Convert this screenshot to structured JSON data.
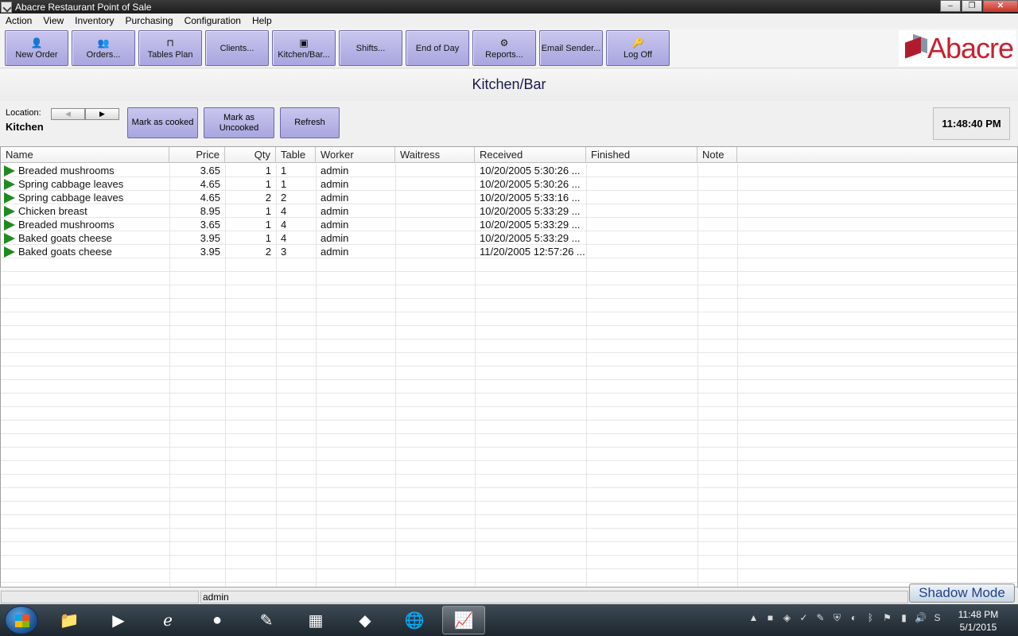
{
  "window": {
    "title": "Abacre Restaurant Point of Sale"
  },
  "menu": [
    "Action",
    "View",
    "Inventory",
    "Purchasing",
    "Configuration",
    "Help"
  ],
  "toolbar": {
    "buttons": [
      "New Order",
      "Orders...",
      "Tables Plan",
      "Clients...",
      "Kitchen/Bar...",
      "Shifts...",
      "End of Day",
      "Reports...",
      "Email Sender...",
      "Log Off"
    ],
    "logo": "Abacre"
  },
  "heading": "Kitchen/Bar",
  "controls": {
    "location_label": "Location:",
    "location_value": "Kitchen",
    "mark_cooked": "Mark as cooked",
    "mark_uncooked": "Mark as Uncooked",
    "refresh": "Refresh",
    "clock": "11:48:40 PM"
  },
  "grid": {
    "columns": [
      "Name",
      "Price",
      "Qty",
      "Table",
      "Worker",
      "Waitress",
      "Received",
      "Finished",
      "Note"
    ],
    "rows": [
      {
        "name": "Breaded mushrooms",
        "price": "3.65",
        "qty": "1",
        "table": "1",
        "worker": "admin",
        "waitress": "",
        "received": "10/20/2005 5:30:26 ...",
        "finished": "",
        "note": ""
      },
      {
        "name": "Spring cabbage leaves",
        "price": "4.65",
        "qty": "1",
        "table": "1",
        "worker": "admin",
        "waitress": "",
        "received": "10/20/2005 5:30:26 ...",
        "finished": "",
        "note": ""
      },
      {
        "name": "Spring cabbage leaves",
        "price": "4.65",
        "qty": "2",
        "table": "2",
        "worker": "admin",
        "waitress": "",
        "received": "10/20/2005 5:33:16 ...",
        "finished": "",
        "note": ""
      },
      {
        "name": "Chicken breast",
        "price": "8.95",
        "qty": "1",
        "table": "4",
        "worker": "admin",
        "waitress": "",
        "received": "10/20/2005 5:33:29 ...",
        "finished": "",
        "note": ""
      },
      {
        "name": "Breaded mushrooms",
        "price": "3.65",
        "qty": "1",
        "table": "4",
        "worker": "admin",
        "waitress": "",
        "received": "10/20/2005 5:33:29 ...",
        "finished": "",
        "note": ""
      },
      {
        "name": "Baked goats cheese",
        "price": "3.95",
        "qty": "1",
        "table": "4",
        "worker": "admin",
        "waitress": "",
        "received": "10/20/2005 5:33:29 ...",
        "finished": "",
        "note": ""
      },
      {
        "name": "Baked goats cheese",
        "price": "3.95",
        "qty": "2",
        "table": "3",
        "worker": "admin",
        "waitress": "",
        "received": "11/20/2005 12:57:26 ...",
        "finished": "",
        "note": ""
      }
    ]
  },
  "status": {
    "user": "admin",
    "shadow_mode": "Shadow Mode"
  },
  "taskbar": {
    "time": "11:48 PM",
    "date": "5/1/2015"
  }
}
